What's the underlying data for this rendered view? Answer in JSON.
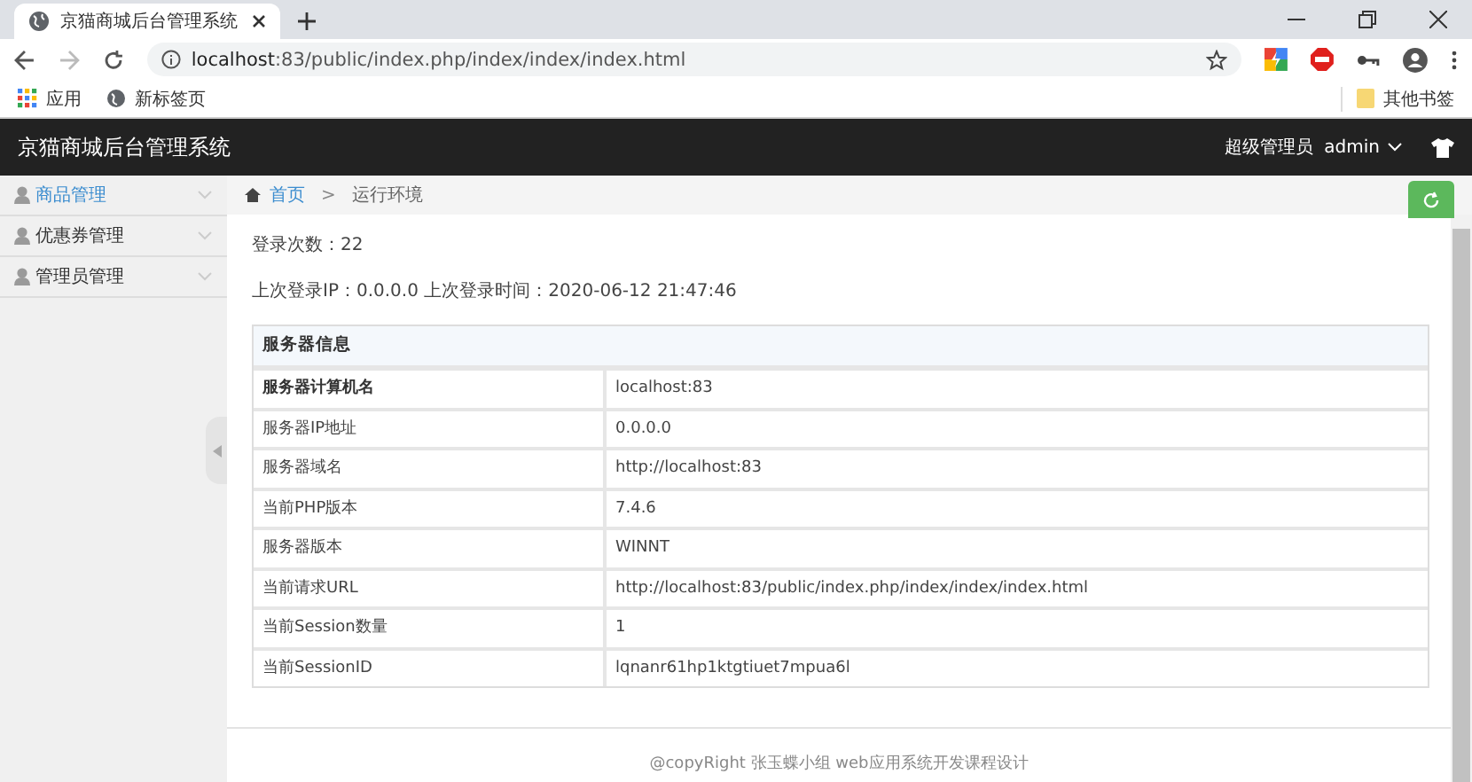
{
  "browser": {
    "tab_title": "京猫商城后台管理系统",
    "address_host": "localhost",
    "address_rest": ":83/public/index.php/index/index/index.html",
    "bookmarks": [
      "应用",
      "新标签页"
    ],
    "other_bookmarks": "其他书签"
  },
  "header": {
    "title": "京猫商城后台管理系统",
    "role": "超级管理员",
    "user": "admin"
  },
  "sidebar": {
    "items": [
      {
        "label": "商品管理",
        "selected": true
      },
      {
        "label": "优惠券管理",
        "selected": false
      },
      {
        "label": "管理员管理",
        "selected": false
      }
    ]
  },
  "breadcrumb": {
    "home": "首页",
    "separator": ">",
    "current": "运行环境"
  },
  "stats": [
    "登录次数：22",
    "上次登录IP：0.0.0.0 上次登录时间：2020-06-12 21:47:46"
  ],
  "table": {
    "title": "服务器信息",
    "rows": [
      {
        "label": "服务器计算机名",
        "value": "localhost:83",
        "bold": true
      },
      {
        "label": "服务器IP地址",
        "value": "0.0.0.0",
        "bold": false
      },
      {
        "label": "服务器域名",
        "value": "http://localhost:83",
        "bold": false
      },
      {
        "label": "当前PHP版本",
        "value": "7.4.6",
        "bold": false
      },
      {
        "label": "服务器版本",
        "value": "WINNT",
        "bold": false
      },
      {
        "label": "当前请求URL",
        "value": "http://localhost:83/public/index.php/index/index/index.html",
        "bold": false
      },
      {
        "label": "当前Session数量",
        "value": "1",
        "bold": false
      },
      {
        "label": "当前SessionID",
        "value": "lqnanr61hp1ktgtiuet7mpua6l",
        "bold": false
      }
    ]
  },
  "footer": "@copyRight 张玉蝶小组 web应用系统开发课程设计"
}
